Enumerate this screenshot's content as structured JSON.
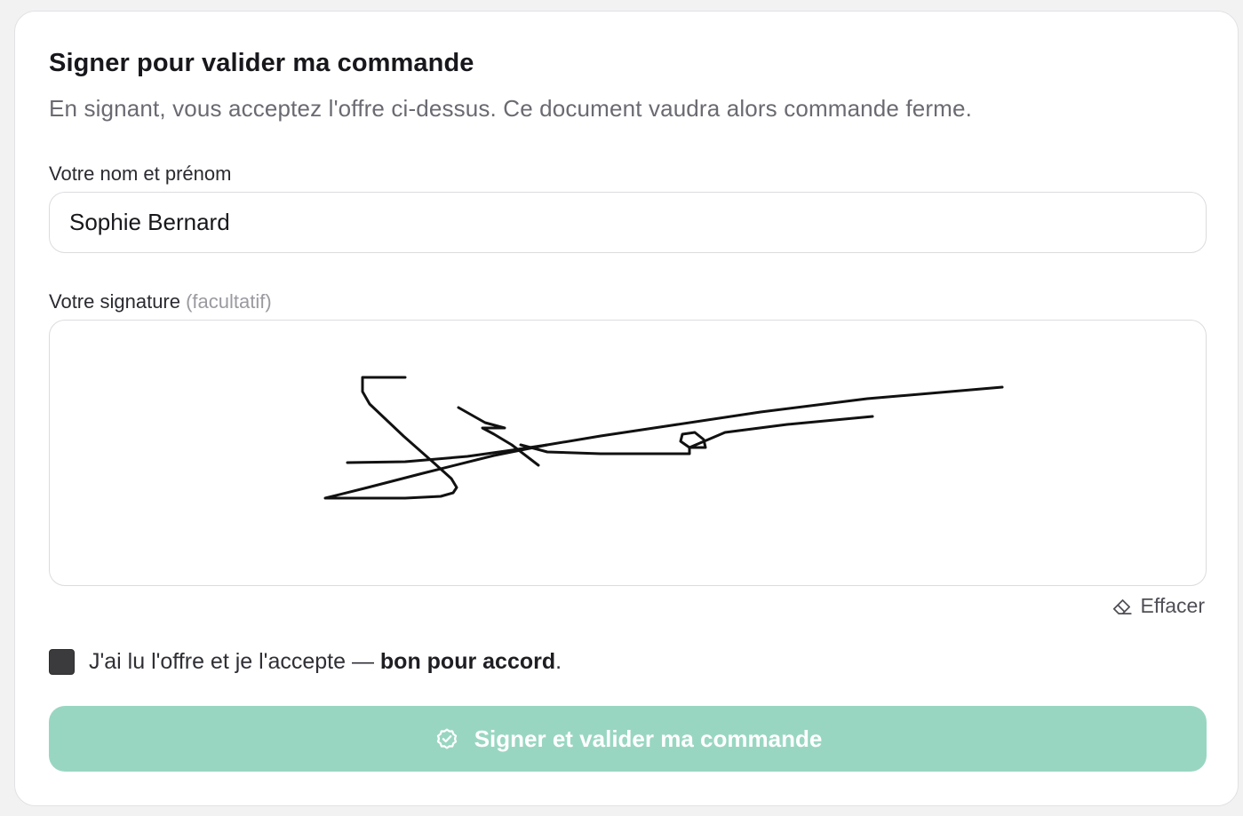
{
  "form": {
    "title": "Signer pour valider ma commande",
    "subtitle": "En signant, vous acceptez l'offre ci-dessus. Ce document vaudra alors commande ferme.",
    "name_label": "Votre nom et prénom",
    "name_value": "Sophie Bernard",
    "signature_label": "Votre signature",
    "signature_optional": "(facultatif)",
    "clear_label": "Effacer",
    "clear_icon": "eraser-icon",
    "consent_text": "J'ai lu l'offre et je l'accepte — ",
    "consent_strong": "bon pour accord",
    "consent_end": ".",
    "consent_checked": true,
    "submit_label": "Signer et valider ma commande",
    "submit_icon": "check-circle-icon"
  },
  "colors": {
    "submit_bg": "#99d6c2",
    "checkbox": "#3b3b3e",
    "ink": "#111111"
  }
}
